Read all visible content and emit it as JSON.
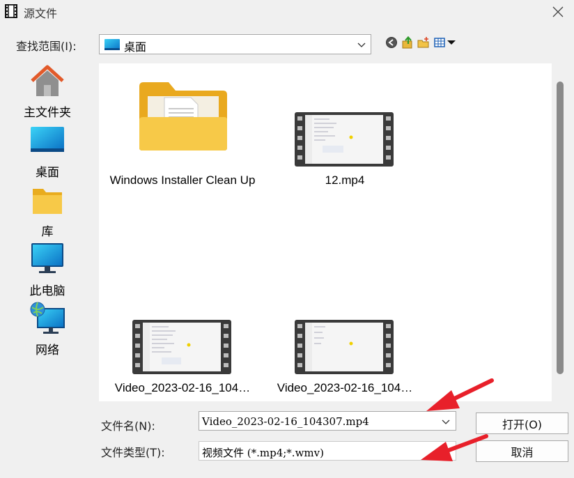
{
  "window": {
    "title": "源文件",
    "close_icon": "close-icon"
  },
  "look_in": {
    "label": "查找范围(I):",
    "value": "桌面"
  },
  "toolbar": {
    "back_icon": "back-icon",
    "up_icon": "up-folder-icon",
    "new_folder_icon": "new-folder-icon",
    "view_menu_icon": "view-menu-icon"
  },
  "places": [
    {
      "label": "主文件夹",
      "icon": "home-icon"
    },
    {
      "label": "桌面",
      "icon": "desktop-icon"
    },
    {
      "label": "库",
      "icon": "library-icon"
    },
    {
      "label": "此电脑",
      "icon": "computer-icon"
    },
    {
      "label": "网络",
      "icon": "network-icon"
    }
  ],
  "files": [
    {
      "name": "Windows Installer Clean Up",
      "kind": "folder"
    },
    {
      "name": "12.mp4",
      "kind": "video"
    },
    {
      "name": "Video_2023-02-16_104…",
      "kind": "video"
    },
    {
      "name": "Video_2023-02-16_104…",
      "kind": "video"
    }
  ],
  "file_name": {
    "label": "文件名(N):",
    "value": "Video_2023-02-16_104307.mp4"
  },
  "file_type": {
    "label": "文件类型(T):",
    "value": "视频文件 (*.mp4;*.wmv)"
  },
  "buttons": {
    "open": "打开(O)",
    "cancel": "取消"
  },
  "colors": {
    "annotation_arrow": "#e8202a",
    "folder_yellow": "#f7c948",
    "scrollbar_thumb": "#8a8a8a"
  }
}
